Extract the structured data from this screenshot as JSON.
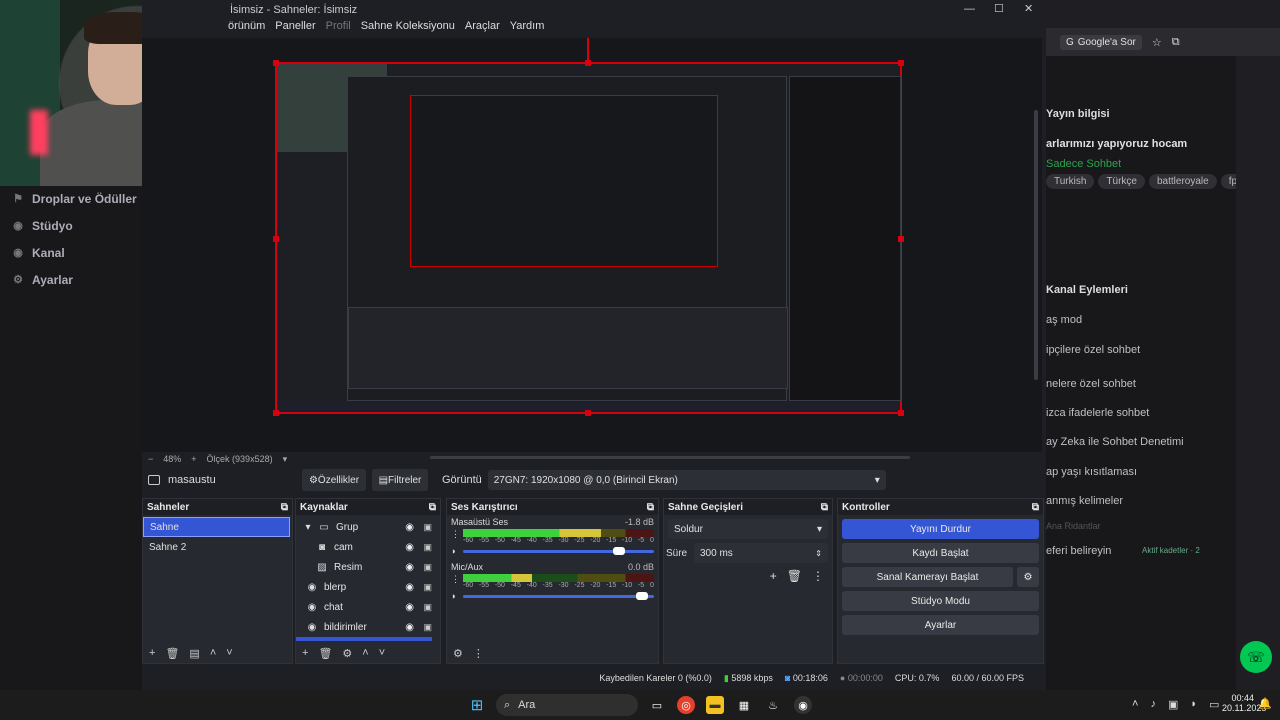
{
  "twitch_nav": {
    "items": [
      {
        "label": "Droplar ve Ödüller",
        "icon": "gift-icon"
      },
      {
        "label": "Stüdyo",
        "icon": "studio-icon"
      },
      {
        "label": "Kanal",
        "icon": "channel-icon"
      },
      {
        "label": "Ayarlar",
        "icon": "gear-icon"
      }
    ]
  },
  "browser": {
    "google_button": "Google'a Sor",
    "stream_info_title": "Yayın bilgisi",
    "stream_title": "arlarımızı yapıyoruz hocam",
    "category": "Sadece Sohbet",
    "tags": [
      "Turkish",
      "Türkçe",
      "battleroyale",
      "fp"
    ],
    "channel_actions_title": "Kanal Eylemleri",
    "actions": [
      "aş mod",
      "ipçilere özel sohbet",
      "nelere özel sohbet",
      "izca ifadelerle sohbet",
      "ay Zeka ile Sohbet Denetimi",
      "ap yaşı kısıtlaması",
      "anmış kelimeler",
      "eferi belireyin"
    ],
    "hint": "Ana Ridantlar",
    "active_hint": "Aktif kadetler · 2"
  },
  "obs": {
    "window_title": "İsimsiz - Sahneler: İsimsiz",
    "menu": [
      "örünüm",
      "Paneller",
      "Profil",
      "Sahne Koleksiyonu",
      "Araçlar",
      "Yardım"
    ],
    "zoom": "48%",
    "scale_label": "Ölçek (939x528)",
    "source_name": "masaustu",
    "properties_label": "Özellikler",
    "filters_label": "Filtreler",
    "display_label": "Görüntü",
    "display_value": "27GN7: 1920x1080 @ 0,0 (Birincil Ekran)",
    "scenes": {
      "title": "Sahneler",
      "items": [
        "Sahne",
        "Sahne 2"
      ],
      "selected": 0
    },
    "sources": {
      "title": "Kaynaklar",
      "items": [
        {
          "name": "Grup",
          "icon": "folder-icon",
          "indent": 0,
          "group": true
        },
        {
          "name": "cam",
          "icon": "camera-icon",
          "indent": 1
        },
        {
          "name": "Resim",
          "icon": "image-icon",
          "indent": 1
        },
        {
          "name": "blerp",
          "icon": "browser-source-icon",
          "indent": 0
        },
        {
          "name": "chat",
          "icon": "browser-source-icon",
          "indent": 0
        },
        {
          "name": "bildirimler",
          "icon": "browser-source-icon",
          "indent": 0
        }
      ]
    },
    "mixer": {
      "title": "Ses Karıştırıcı",
      "channels": [
        {
          "name": "Masaüstü Ses",
          "db": "-1.8 dB",
          "level": 0.72,
          "volume": 0.85
        },
        {
          "name": "Mic/Aux",
          "db": "0.0 dB",
          "level": 0.36,
          "volume": 0.97
        }
      ],
      "ticks": [
        "-60",
        "-55",
        "-50",
        "-45",
        "-40",
        "-35",
        "-30",
        "-25",
        "-20",
        "-15",
        "-10",
        "-5",
        "0"
      ]
    },
    "transitions": {
      "title": "Sahne Geçişleri",
      "selected": "Soldur",
      "duration_label": "Süre",
      "duration_value": "300 ms"
    },
    "controls": {
      "title": "Kontroller",
      "stop_stream": "Yayını Durdur",
      "start_recording": "Kaydı Başlat",
      "virtual_camera": "Sanal Kamerayı Başlat",
      "studio_mode": "Stüdyo Modu",
      "settings": "Ayarlar"
    },
    "status": {
      "dropped": "Kaybedilen Kareler 0 (%0.0)",
      "bitrate": "5898 kbps",
      "live_time": "00:18:06",
      "rec_time": "00:00:00",
      "cpu": "CPU: 0.7%",
      "fps": "60.00 / 60.00 FPS"
    }
  },
  "taskbar": {
    "search_label": "Ara",
    "time": "00:44",
    "date": "20.11.2025"
  }
}
